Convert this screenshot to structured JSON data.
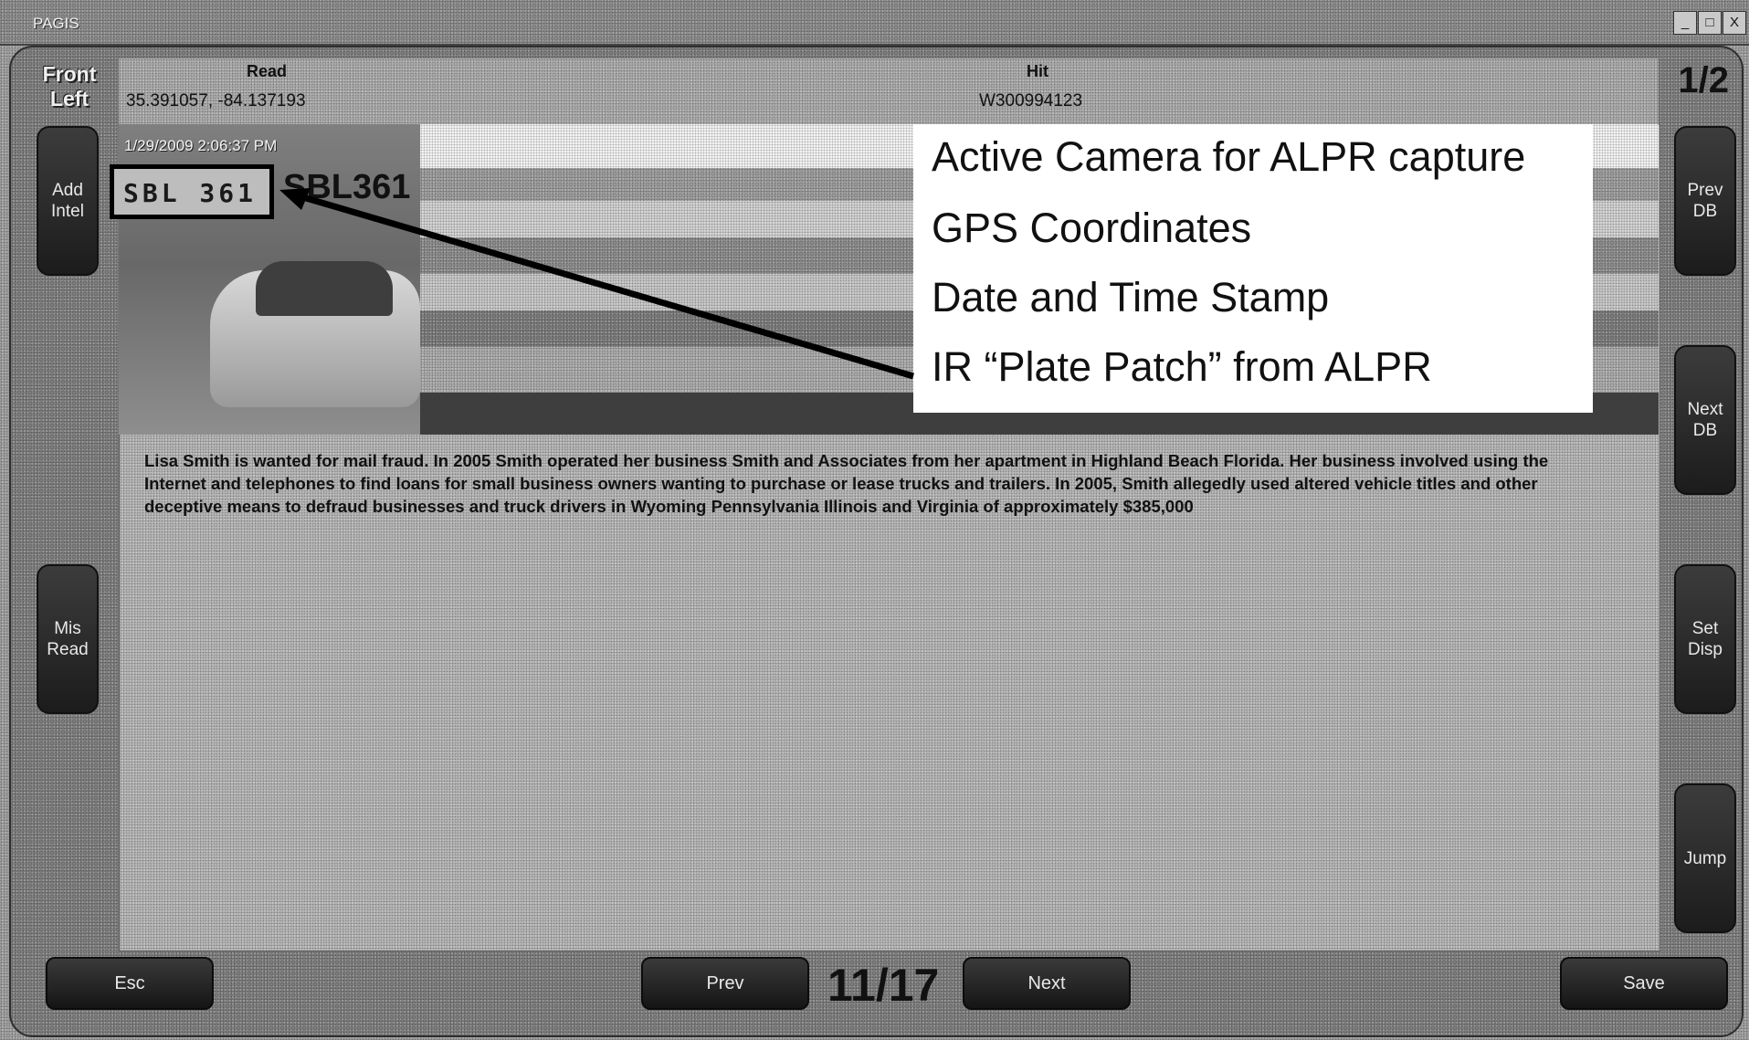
{
  "window": {
    "title": "PAGIS",
    "controls": [
      "_",
      "□",
      "X"
    ]
  },
  "header": {
    "camera_label": "Front Left",
    "read_label": "Read",
    "coordinates": "35.391057, -84.137193",
    "hit_label": "Hit",
    "hit_id": "W300994123",
    "page_indicator": "1/2"
  },
  "image": {
    "timestamp": "1/29/2009 2:06:37 PM",
    "plate_patch_text": "SBL 361",
    "plate_read": "SBL361"
  },
  "callout": {
    "lines": [
      "Active Camera for ALPR capture",
      "GPS Coordinates",
      "Date and Time Stamp",
      "IR  “Plate Patch” from ALPR"
    ]
  },
  "description": "Lisa Smith is wanted for mail fraud. In 2005 Smith operated her business Smith and Associates from her apartment in Highland Beach Florida. Her business involved using the Internet and telephones to find loans for small business owners wanting to purchase or lease trucks and trailers. In 2005, Smith allegedly used altered vehicle titles and other deceptive means to defraud businesses and truck drivers in Wyoming Pennsylvania Illinois and Virginia of approximately $385,000",
  "left_buttons": {
    "add_intel": "Add\nIntel",
    "mis_read": "Mis\nRead"
  },
  "right_buttons": {
    "prev_db": "Prev\nDB",
    "next_db": "Next\nDB",
    "set_disp": "Set\nDisp",
    "jump": "Jump"
  },
  "footer": {
    "esc": "Esc",
    "prev": "Prev",
    "counter": "11/17",
    "next": "Next",
    "save": "Save"
  }
}
